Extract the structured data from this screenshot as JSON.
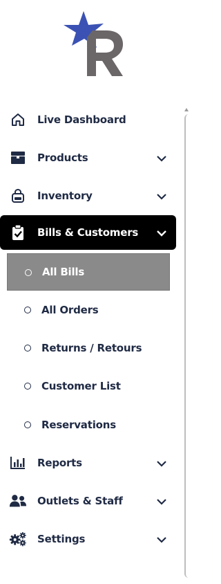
{
  "brand": {
    "letter": "R",
    "colors": {
      "star": "#3b52b4",
      "letter": "#6b6668"
    }
  },
  "nav": {
    "dashboard": {
      "label": "Live Dashboard",
      "icon": "home-icon"
    },
    "products": {
      "label": "Products",
      "icon": "box-icon"
    },
    "inventory": {
      "label": "Inventory",
      "icon": "bag-icon"
    },
    "bills": {
      "label": "Bills & Customers",
      "icon": "clipboard-check-icon",
      "sub": [
        "All Bills",
        "All Orders",
        "Returns / Retours",
        "Customer List",
        "Reservations"
      ],
      "selected": "All Bills"
    },
    "reports": {
      "label": "Reports",
      "icon": "bar-chart-icon"
    },
    "outlets": {
      "label": "Outlets & Staff",
      "icon": "users-icon"
    },
    "settings": {
      "label": "Settings",
      "icon": "gears-icon"
    }
  },
  "colors": {
    "text": "#1f2a44",
    "active_bg": "#000000",
    "sub_active_bg": "#8a8a8a"
  }
}
